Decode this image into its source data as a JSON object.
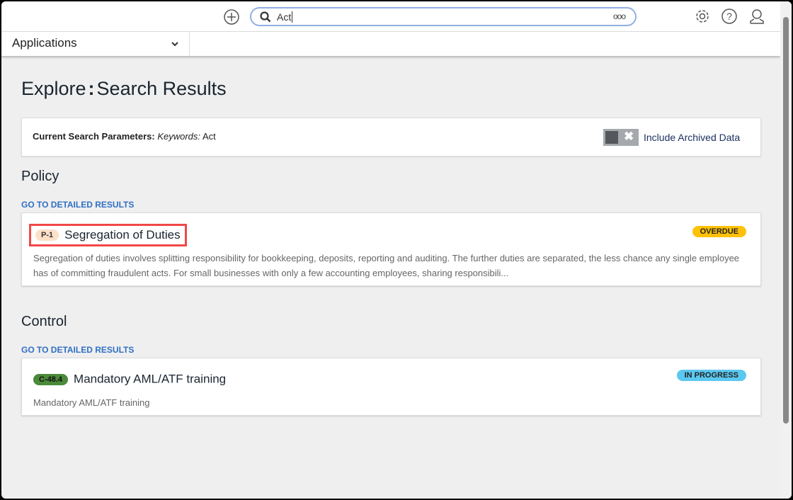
{
  "topbar": {
    "search_value": "Act",
    "more_label": "ooo"
  },
  "appbar": {
    "applications_label": "Applications"
  },
  "page": {
    "title_prefix": "Explore",
    "title_sep": ":",
    "title": "Search Results"
  },
  "params": {
    "label": "Current Search Parameters:",
    "keywords_label": "Keywords:",
    "keywords_value": "Act",
    "archived_label": "Include Archived Data",
    "archived_on": false
  },
  "sections": [
    {
      "heading": "Policy",
      "link": "GO TO DETAILED RESULTS",
      "result": {
        "id": "P-1",
        "title": "Segregation of Duties",
        "status": "OVERDUE",
        "description": "Segregation of duties involves splitting responsibility for bookkeeping, deposits, reporting and auditing. The further duties are separated, the less chance any single employee has of committing fraudulent acts. For small businesses with only a few accounting employees, sharing responsibili..."
      }
    },
    {
      "heading": "Control",
      "link": "GO TO DETAILED RESULTS",
      "result": {
        "id": "C-48.4",
        "title": "Mandatory AML/ATF training",
        "status": "IN PROGRESS",
        "description": "Mandatory AML/ATF training"
      }
    }
  ],
  "colors": {
    "overdue": "#ffc107",
    "in_progress": "#5bc8f0",
    "policy_pill": "#fde0c8",
    "control_pill": "#4a8a3a",
    "highlight": "#f24848"
  }
}
